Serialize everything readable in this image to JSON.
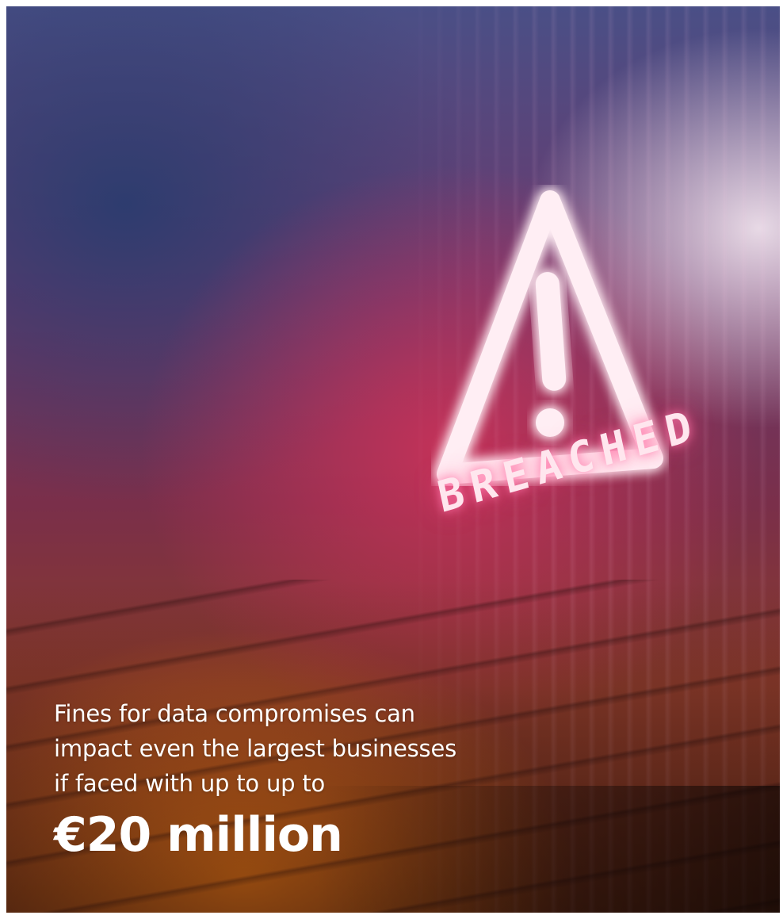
{
  "image": {
    "icon": "warning-triangle-icon",
    "overlay_label": "BREACHED"
  },
  "caption": {
    "lines": [
      "Fines for data compromises can",
      "impact even the largest businesses",
      "if faced with up to up to"
    ],
    "amount": "€20 million"
  },
  "colors": {
    "glow": "#ff6fa6",
    "text": "#ffffff",
    "accent_orange": "#f07814"
  }
}
